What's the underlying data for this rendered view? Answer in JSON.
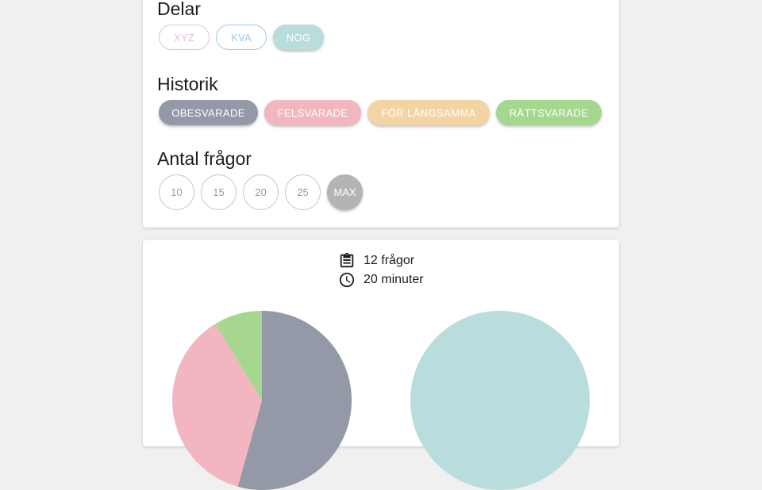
{
  "parts": {
    "title": "Delar",
    "items": [
      {
        "label": "XYZ",
        "color": "#e3bde9",
        "selected": false
      },
      {
        "label": "KVA",
        "color": "#9cc9f0",
        "selected": false
      },
      {
        "label": "NOG",
        "color": "#b9dcdc",
        "selected": true
      }
    ]
  },
  "history": {
    "title": "Historik",
    "items": [
      {
        "label": "OBESVARADE",
        "color": "#9499a7"
      },
      {
        "label": "FELSVARADE",
        "color": "#f1b6c0"
      },
      {
        "label": "FÖR LÅNGSAMMA",
        "color": "#f5d4a3"
      },
      {
        "label": "RÄTTSVARADE",
        "color": "#a5d78f"
      }
    ]
  },
  "count": {
    "title": "Antal frågor",
    "options": [
      "10",
      "15",
      "20",
      "25",
      "MAX"
    ],
    "selected": "MAX"
  },
  "summary": {
    "questions": "12 frågor",
    "time": "20 minuter",
    "questions_icon": "clipboard-icon",
    "time_icon": "clock-icon"
  },
  "chart_data": [
    {
      "type": "pie",
      "slices": [
        {
          "label": "OBESVARADE",
          "value": 50,
          "color": "#9499a7"
        },
        {
          "label": "FELSVARADE",
          "value": 34,
          "color": "#f1b6c0"
        },
        {
          "label": "RÄTTSVARADE",
          "value": 8,
          "color": "#a5d78f"
        }
      ]
    },
    {
      "type": "pie",
      "slices": [
        {
          "label": "NOG",
          "value": 100,
          "color": "#b9dcdc"
        }
      ]
    }
  ]
}
